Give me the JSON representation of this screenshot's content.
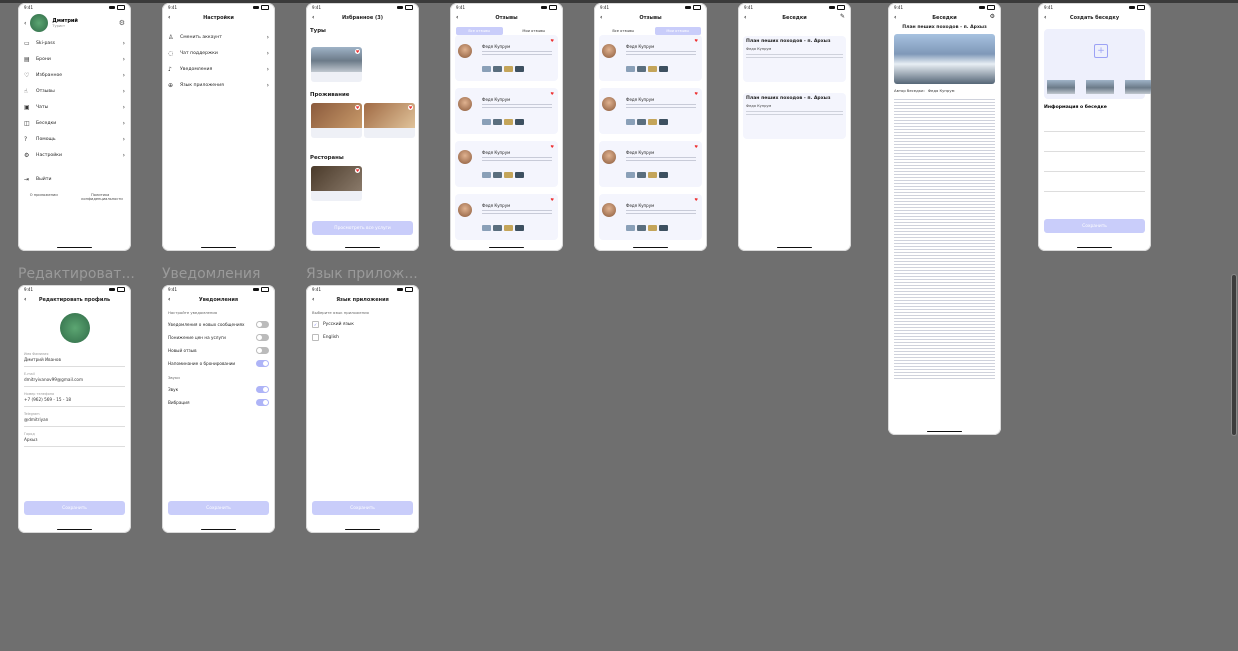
{
  "status_time": "9:41",
  "frame_captions": {
    "edit": "Редактироват...",
    "notif": "Уведомления",
    "lang": "Язык прилож..."
  },
  "menu": {
    "name": "Дмитрий",
    "role": "Турист",
    "items": [
      {
        "label": "Ski-pass",
        "icon": "ski-icon"
      },
      {
        "label": "Брони",
        "icon": "calendar-icon"
      },
      {
        "label": "Избранное",
        "icon": "heart-icon"
      },
      {
        "label": "Отзывы",
        "icon": "thumb-icon"
      },
      {
        "label": "Чаты",
        "icon": "chat-icon"
      },
      {
        "label": "Беседки",
        "icon": "chat-bubble-icon"
      },
      {
        "label": "Помощь",
        "icon": "help-icon"
      },
      {
        "label": "Настройки",
        "icon": "gear-icon"
      }
    ],
    "logout": "Выйти",
    "about": "О приложении",
    "privacy": "Политика конфиденциальности"
  },
  "settings": {
    "title": "Настройки",
    "items": [
      "Сменить аккаунт",
      "Чат поддержки",
      "Уведомления",
      "Язык приложения"
    ]
  },
  "favorites": {
    "title": "Избранное (3)",
    "sections": [
      "Туры",
      "Проживание",
      "Рестораны"
    ],
    "button": "Просмотреть все услуги"
  },
  "reviews": {
    "title": "Отзывы",
    "tab_all": "Все отзывы",
    "tab_mine": "Мои отзывы",
    "author": "Федя Купрум"
  },
  "chat_list": {
    "title": "Беседки",
    "items": [
      {
        "title": "План пеших походов - п. Архыз",
        "author": "Федя Купрум"
      },
      {
        "title": "План пеших походов - п. Архыз",
        "author": "Федя Купрум"
      }
    ]
  },
  "chat_detail": {
    "title": "Беседки",
    "heading": "План пеших походов - п. Архыз",
    "author_label": "Автор беседки:",
    "author": "Федя Купрум"
  },
  "create_chat": {
    "title": "Создать беседку",
    "info": "Информация о беседке",
    "button": "Сохранить"
  },
  "edit_profile": {
    "title": "Редактировать профиль",
    "fields": [
      {
        "label": "Имя Фамилия",
        "value": "Дмитрий Иванов"
      },
      {
        "label": "E-mail",
        "value": "dmitryivanov99@gmail.com"
      },
      {
        "label": "Номер телефона",
        "value": "+7 (962) 569 - 15 - 18"
      },
      {
        "label": "Telegram",
        "value": "@dmitriyan"
      },
      {
        "label": "Город",
        "value": "Архыз"
      }
    ],
    "button": "Сохранить"
  },
  "notifications": {
    "title": "Уведомления",
    "subtitle": "Настройте уведомления",
    "toggles": [
      {
        "label": "Уведомления о новых сообщениях",
        "on": false
      },
      {
        "label": "Понижение цен на услуги",
        "on": false
      },
      {
        "label": "Новый отзыв",
        "on": false
      },
      {
        "label": "Напоминание о бронировании",
        "on": true
      }
    ],
    "sound_header": "Звуки",
    "sound_toggles": [
      {
        "label": "Звук",
        "on": true
      },
      {
        "label": "Вибрация",
        "on": true
      }
    ],
    "button": "Сохранить"
  },
  "language": {
    "title": "Язык приложения",
    "subtitle": "Выберите язык приложения",
    "options": [
      {
        "label": "Русский язык",
        "checked": true
      },
      {
        "label": "English",
        "checked": false
      }
    ],
    "button": "Сохранить"
  }
}
